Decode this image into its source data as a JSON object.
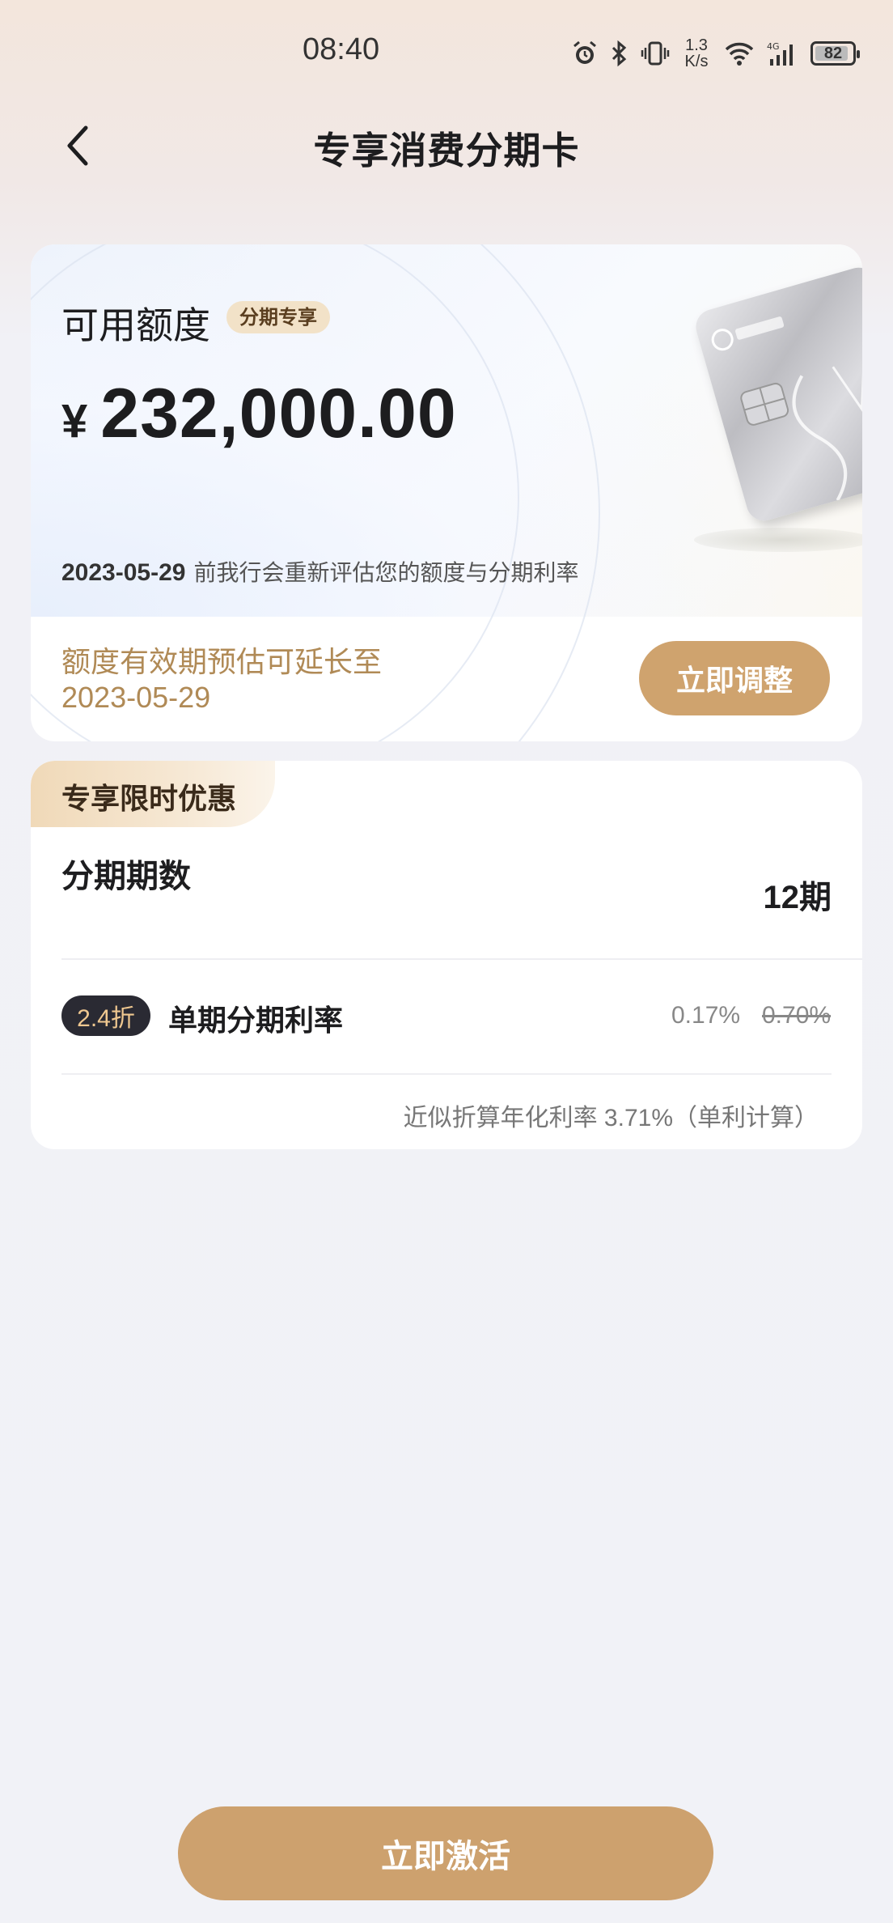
{
  "status_bar": {
    "time": "08:40",
    "net_speed": "1.3\nK/s",
    "battery": "82",
    "icons": [
      "alarm-icon",
      "bluetooth-icon",
      "vibrate-icon",
      "wifi-icon",
      "signal-icon",
      "battery-icon"
    ]
  },
  "nav": {
    "title": "专享消费分期卡",
    "back_icon": "chevron-left-icon"
  },
  "limit_card": {
    "label": "可用额度",
    "badge": "分期专享",
    "currency": "¥",
    "amount": "232,000.00",
    "reval_date": "2023-05-29",
    "reval_text": "前我行会重新评估您的额度与分期利率",
    "valid_line1": "额度有效期预估可延长至",
    "valid_line2": "2023-05-29",
    "adjust_button": "立即调整"
  },
  "offer_card": {
    "tag": "专享限时优惠",
    "term_label": "分期期数",
    "term_value": "12期",
    "discount": "2.4折",
    "rate_label": "单期分期利率",
    "rate_new": "0.17%",
    "rate_old": "0.70%",
    "annual_note": "近似折算年化利率 3.71%（单利计算）"
  },
  "activate_button": "立即激活",
  "colors": {
    "accent": "#cda16e",
    "gold_text": "#b08a56",
    "badge_dark": "#2a2a33"
  }
}
